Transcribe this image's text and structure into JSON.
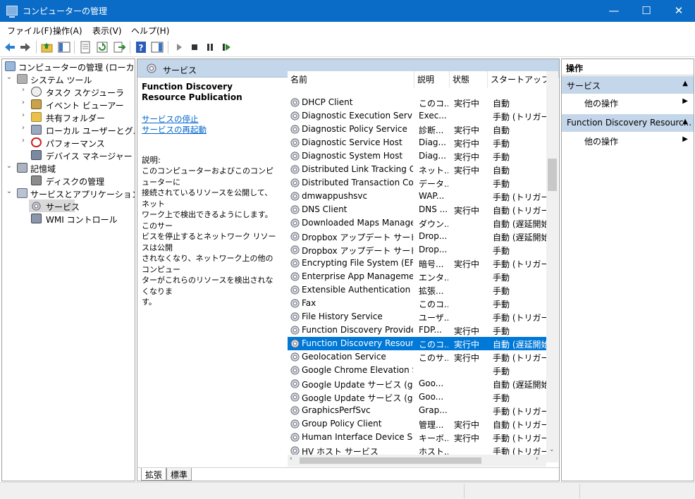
{
  "window": {
    "title": "コンピューターの管理",
    "controls": {
      "minimize": "—",
      "maximize": "☐",
      "close": "✕"
    }
  },
  "menu": [
    "ファイル(F)",
    "操作(A)",
    "表示(V)",
    "ヘルプ(H)"
  ],
  "tree": {
    "root": "コンピューターの管理 (ローカル)",
    "system_tools": "システム ツール",
    "task_scheduler": "タスク スケジューラ",
    "event_viewer": "イベント ビューアー",
    "shared_folders": "共有フォルダー",
    "local_users": "ローカル ユーザーとグループ",
    "performance": "パフォーマンス",
    "device_manager": "デバイス マネージャー",
    "storage": "記憶域",
    "disk_management": "ディスクの管理",
    "services_apps": "サービスとアプリケーション",
    "services": "サービス",
    "wmi": "WMI コントロール"
  },
  "center": {
    "header": "サービス",
    "selected_title": "Function Discovery Resource Publication",
    "link_stop": "サービスの停止",
    "link_restart": "サービスの再起動",
    "desc_label": "説明:",
    "desc_lines": [
      "このコンピューターおよびこのコンピューターに",
      "接続されているリソースを公開して、ネット",
      "ワーク上で検出できるようにします。このサー",
      "ビスを停止するとネットワーク リソースは公開",
      "されなくなり、ネットワーク上の他のコンピュー",
      "ターがこれらのリソースを検出されなくなりま",
      "す。"
    ],
    "columns": {
      "name": "名前",
      "desc": "説明",
      "state": "状態",
      "startup": "スタートアップの種"
    },
    "tabs": [
      "拡張",
      "標準"
    ]
  },
  "services": [
    {
      "name": "DHCP Client",
      "desc": "このコ...",
      "state": "実行中",
      "startup": "自動"
    },
    {
      "name": "Diagnostic Execution Service",
      "desc": "Exec...",
      "state": "",
      "startup": "手動 (トリガー開"
    },
    {
      "name": "Diagnostic Policy Service",
      "desc": "診断...",
      "state": "実行中",
      "startup": "自動"
    },
    {
      "name": "Diagnostic Service Host",
      "desc": "Diag...",
      "state": "実行中",
      "startup": "手動"
    },
    {
      "name": "Diagnostic System Host",
      "desc": "Diag...",
      "state": "実行中",
      "startup": "手動"
    },
    {
      "name": "Distributed Link Tracking Cli...",
      "desc": "ネット...",
      "state": "実行中",
      "startup": "自動"
    },
    {
      "name": "Distributed Transaction Coo...",
      "desc": "データ...",
      "state": "",
      "startup": "手動"
    },
    {
      "name": "dmwappushsvc",
      "desc": "WAP...",
      "state": "",
      "startup": "手動 (トリガー開"
    },
    {
      "name": "DNS Client",
      "desc": "DNS ...",
      "state": "実行中",
      "startup": "自動 (トリガー開"
    },
    {
      "name": "Downloaded Maps Manager",
      "desc": "ダウン...",
      "state": "",
      "startup": "自動 (遅延開始"
    },
    {
      "name": "Dropbox アップデート サービス (...",
      "desc": "Drop...",
      "state": "",
      "startup": "自動 (遅延開始"
    },
    {
      "name": "Dropbox アップデート サービス (...",
      "desc": "Drop...",
      "state": "",
      "startup": "手動"
    },
    {
      "name": "Encrypting File System (EFS)",
      "desc": "暗号...",
      "state": "実行中",
      "startup": "手動 (トリガー開"
    },
    {
      "name": "Enterprise App Managemen...",
      "desc": "エンタ...",
      "state": "",
      "startup": "手動"
    },
    {
      "name": "Extensible Authentication P...",
      "desc": "拡張...",
      "state": "",
      "startup": "手動"
    },
    {
      "name": "Fax",
      "desc": "このコ...",
      "state": "",
      "startup": "手動"
    },
    {
      "name": "File History Service",
      "desc": "ユーザ...",
      "state": "",
      "startup": "手動 (トリガー開"
    },
    {
      "name": "Function Discovery Provider...",
      "desc": "FDP...",
      "state": "実行中",
      "startup": "手動"
    },
    {
      "name": "Function Discovery Resourc...",
      "desc": "このコ...",
      "state": "実行中",
      "startup": "自動 (遅延開始",
      "selected": true
    },
    {
      "name": "Geolocation Service",
      "desc": "このサ...",
      "state": "実行中",
      "startup": "手動 (トリガー開"
    },
    {
      "name": "Google Chrome Elevation S...",
      "desc": "",
      "state": "",
      "startup": "手動"
    },
    {
      "name": "Google Update サービス (gup...",
      "desc": "Goo...",
      "state": "",
      "startup": "自動 (遅延開始"
    },
    {
      "name": "Google Update サービス (gup...",
      "desc": "Goo...",
      "state": "",
      "startup": "手動"
    },
    {
      "name": "GraphicsPerfSvc",
      "desc": "Grap...",
      "state": "",
      "startup": "手動 (トリガー開"
    },
    {
      "name": "Group Policy Client",
      "desc": "管理...",
      "state": "実行中",
      "startup": "自動 (トリガー開"
    },
    {
      "name": "Human Interface Device Ser...",
      "desc": "キーボ...",
      "state": "実行中",
      "startup": "手動 (トリガー開"
    },
    {
      "name": "HV ホスト サービス",
      "desc": "ホスト...",
      "state": "",
      "startup": "手動 (トリガー開"
    }
  ],
  "actions": {
    "header": "操作",
    "section1": "サービス",
    "more1": "他の操作",
    "section2": "Function Discovery Resourc...",
    "more2": "他の操作"
  },
  "colors": {
    "titlebar": "#0a6cc7",
    "selection": "#0078d7",
    "header_band": "#c4d6e9"
  }
}
